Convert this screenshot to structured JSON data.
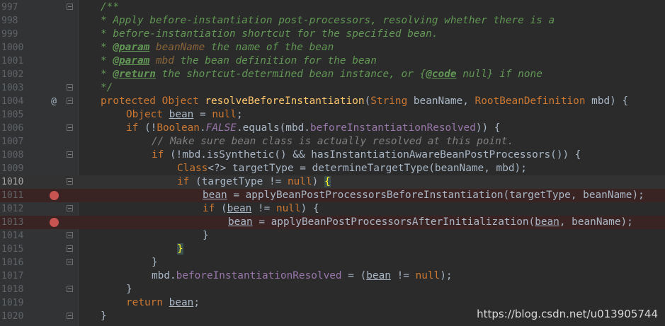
{
  "editor": {
    "lines": [
      {
        "n": "997",
        "fold": "open",
        "marker": "",
        "bp": false,
        "cls": ""
      },
      {
        "n": "998",
        "fold": "",
        "marker": "",
        "bp": false,
        "cls": ""
      },
      {
        "n": "999",
        "fold": "",
        "marker": "",
        "bp": false,
        "cls": ""
      },
      {
        "n": "1000",
        "fold": "",
        "marker": "",
        "bp": false,
        "cls": ""
      },
      {
        "n": "1001",
        "fold": "",
        "marker": "",
        "bp": false,
        "cls": ""
      },
      {
        "n": "1002",
        "fold": "",
        "marker": "",
        "bp": false,
        "cls": ""
      },
      {
        "n": "1003",
        "fold": "end",
        "marker": "",
        "bp": false,
        "cls": ""
      },
      {
        "n": "1004",
        "fold": "open",
        "marker": "@",
        "bp": false,
        "cls": ""
      },
      {
        "n": "1005",
        "fold": "",
        "marker": "",
        "bp": false,
        "cls": ""
      },
      {
        "n": "1006",
        "fold": "open",
        "marker": "",
        "bp": false,
        "cls": ""
      },
      {
        "n": "1007",
        "fold": "",
        "marker": "",
        "bp": false,
        "cls": ""
      },
      {
        "n": "1008",
        "fold": "open",
        "marker": "",
        "bp": false,
        "cls": ""
      },
      {
        "n": "1009",
        "fold": "",
        "marker": "",
        "bp": false,
        "cls": ""
      },
      {
        "n": "1010",
        "fold": "open",
        "marker": "",
        "bp": false,
        "cls": "current"
      },
      {
        "n": "1011",
        "fold": "",
        "marker": "",
        "bp": true,
        "cls": "bp"
      },
      {
        "n": "1012",
        "fold": "open",
        "marker": "",
        "bp": false,
        "cls": ""
      },
      {
        "n": "1013",
        "fold": "",
        "marker": "",
        "bp": true,
        "cls": "bp"
      },
      {
        "n": "1014",
        "fold": "end",
        "marker": "",
        "bp": false,
        "cls": ""
      },
      {
        "n": "1015",
        "fold": "end",
        "marker": "",
        "bp": false,
        "cls": ""
      },
      {
        "n": "1016",
        "fold": "end",
        "marker": "",
        "bp": false,
        "cls": ""
      },
      {
        "n": "1017",
        "fold": "",
        "marker": "",
        "bp": false,
        "cls": ""
      },
      {
        "n": "1018",
        "fold": "end",
        "marker": "",
        "bp": false,
        "cls": ""
      },
      {
        "n": "1019",
        "fold": "",
        "marker": "",
        "bp": false,
        "cls": ""
      },
      {
        "n": "1020",
        "fold": "end",
        "marker": "",
        "bp": false,
        "cls": ""
      }
    ],
    "code": [
      "/**",
      "* Apply before-instantiation post-processors, resolving whether there is a",
      "* before-instantiation shortcut for the specified bean.",
      [
        "* ",
        "@param",
        " beanName",
        " the name of the bean"
      ],
      [
        "* ",
        "@param",
        " mbd",
        " the bean definition for the bean"
      ],
      [
        "* ",
        "@return",
        " the shortcut-determined bean instance, or ",
        "{",
        "@code",
        " null",
        "}",
        " if none"
      ],
      "*/",
      [
        "protected",
        " ",
        "Object",
        " ",
        "resolveBeforeInstantiation",
        "(",
        "String",
        " beanName, ",
        "RootBeanDefinition",
        " mbd) {"
      ],
      [
        "Object",
        " ",
        "bean",
        " = ",
        "null",
        ";"
      ],
      [
        "if",
        " (!",
        "Boolean",
        ".",
        "FALSE",
        ".equals(mbd.",
        "beforeInstantiationResolved",
        ")) {"
      ],
      "// Make sure bean class is actually resolved at this point.",
      [
        "if",
        " (!mbd.isSynthetic() && hasInstantiationAwareBeanPostProcessors()) {"
      ],
      [
        "Class",
        "<?>",
        " targetType = determineTargetType(beanName, mbd);"
      ],
      [
        "if",
        " (targetType != ",
        "null",
        ") ",
        "{"
      ],
      [
        "bean",
        " = applyBeanPostProcessorsBeforeInstantiation(targetType, beanName);"
      ],
      [
        "if",
        " (",
        "bean",
        " != ",
        "null",
        ") {"
      ],
      [
        "bean",
        " = applyBeanPostProcessorsAfterInitialization(",
        "bean",
        ", beanName);"
      ],
      "}",
      "}",
      "}",
      [
        "mbd.",
        "beforeInstantiationResolved",
        " = (",
        "bean",
        " != ",
        "null",
        ");"
      ],
      "}",
      [
        "return",
        " ",
        "bean",
        ";"
      ],
      "}"
    ]
  },
  "watermark": "https://blog.csdn.net/u013905744",
  "colors": {
    "background": "#2b2b2b",
    "gutter": "#313335",
    "keyword": "#cc7832",
    "doc_comment": "#629755",
    "line_comment": "#808080",
    "method": "#ffc66d",
    "field": "#9876aa",
    "text": "#a9b7c6",
    "breakpoint": "#c75450"
  }
}
